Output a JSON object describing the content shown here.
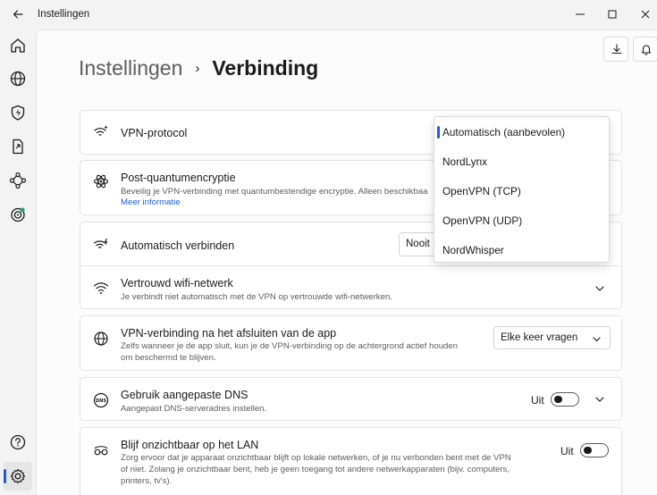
{
  "window": {
    "title": "Instellingen"
  },
  "breadcrumb": {
    "parent": "Instellingen",
    "separator": "›",
    "current": "Verbinding"
  },
  "sidebar": {
    "items": [
      {
        "icon": "home-icon"
      },
      {
        "icon": "globe-icon"
      },
      {
        "icon": "shield-bolt-icon"
      },
      {
        "icon": "file-share-icon"
      },
      {
        "icon": "meshnet-icon"
      },
      {
        "icon": "target-icon"
      },
      {
        "icon": "help-icon"
      },
      {
        "icon": "settings-icon",
        "active": true
      }
    ]
  },
  "settings": {
    "vpn_protocol": {
      "title": "VPN-protocol",
      "value": "Automatisch (aanbevolen)"
    },
    "post_quantum": {
      "title": "Post-quantumencryptie",
      "description": "Beveilig je VPN-verbinding met quantumbestendige encryptie. Alleen beschikbaa",
      "link": "Meer informatie"
    },
    "auto_connect": {
      "title": "Automatisch verbinden",
      "value": "Nooit"
    },
    "trusted_wifi": {
      "title": "Vertrouwd wifi-netwerk",
      "description": "Je verbindt niet automatisch met de VPN op vertrouwde wifi-netwerken."
    },
    "after_close": {
      "title": "VPN-verbinding na het afsluiten van de app",
      "description_line1": "Zelfs wanneer je de app sluit, kun je de VPN-verbinding op de achtergrond actief houden",
      "description_line2": "om beschermd te blijven.",
      "value": "Elke keer vragen"
    },
    "custom_dns": {
      "title": "Gebruik aangepaste DNS",
      "description": "Aangepast DNS-serveradres instellen.",
      "toggle_label": "Uit",
      "enabled": false
    },
    "lan_invisible": {
      "title": "Blijf onzichtbaar op het LAN",
      "description_line1": "Zorg ervoor dat je apparaat onzichtbaar blijft op lokale netwerken, of je nu verbonden bent met de VPN",
      "description_line2": "of niet. Zolang je onzichtbaar bent, heb je geen toegang tot andere netwerkapparaten (bijv. computers,",
      "description_line3": "printers, tv's).",
      "toggle_label": "Uit",
      "enabled": false
    }
  },
  "protocol_dropdown": {
    "options": [
      "Automatisch (aanbevolen)",
      "NordLynx",
      "OpenVPN (TCP)",
      "OpenVPN (UDP)",
      "NordWhisper"
    ],
    "selected_index": 0
  },
  "colors": {
    "accent": "#1f5bd6",
    "link": "#1a5fd6"
  }
}
